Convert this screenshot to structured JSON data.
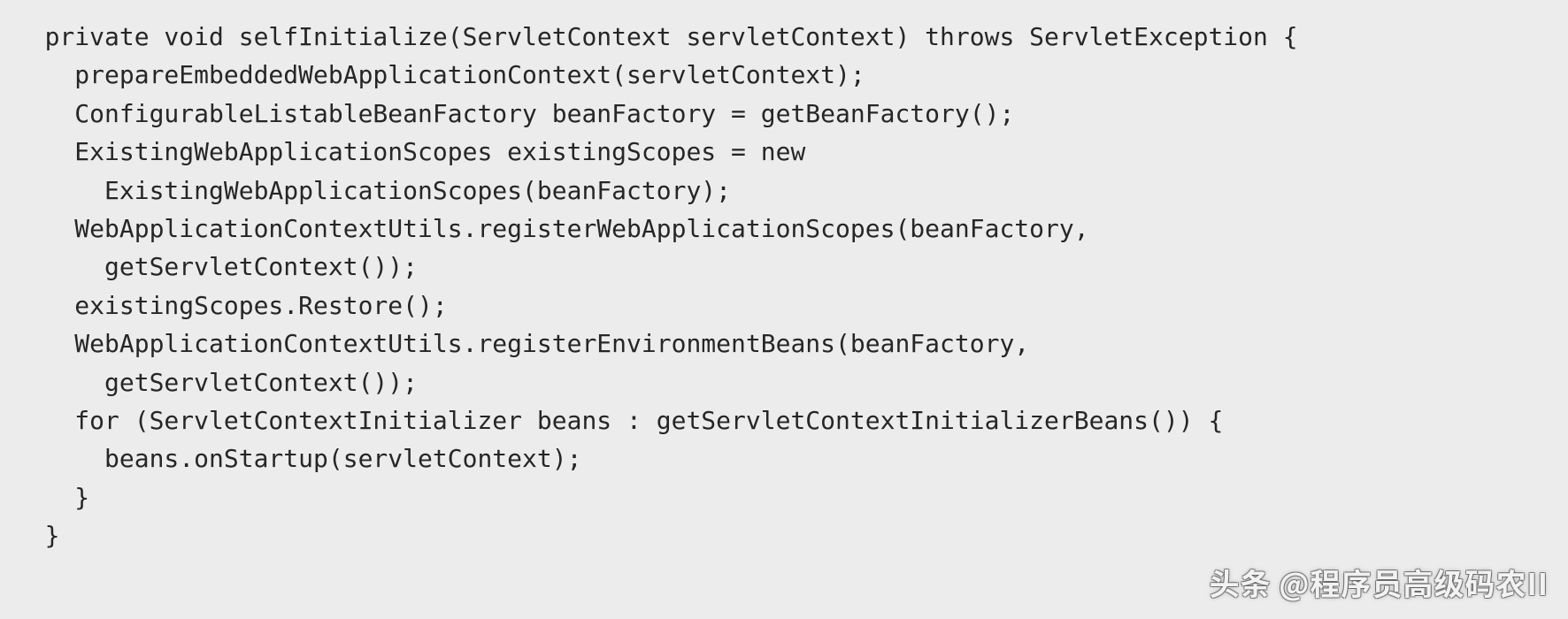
{
  "code": {
    "lines": [
      "   private void selfInitialize(ServletContext servletContext) throws ServletException {",
      "     prepareEmbeddedWebApplicationContext(servletContext);",
      "     ConfigurableListableBeanFactory beanFactory = getBeanFactory();",
      "     ExistingWebApplicationScopes existingScopes = new",
      "       ExistingWebApplicationScopes(beanFactory);",
      "     WebApplicationContextUtils.registerWebApplicationScopes(beanFactory,",
      "       getServletContext());",
      "     existingScopes.Restore();",
      "     WebApplicationContextUtils.registerEnvironmentBeans(beanFactory,",
      "       getServletContext());",
      "     for (ServletContextInitializer beans : getServletContextInitializerBeans()) {",
      "       beans.onStartup(servletContext);",
      "     }",
      "   }"
    ]
  },
  "watermark": {
    "text": "头条 @程序员高级码农II"
  }
}
